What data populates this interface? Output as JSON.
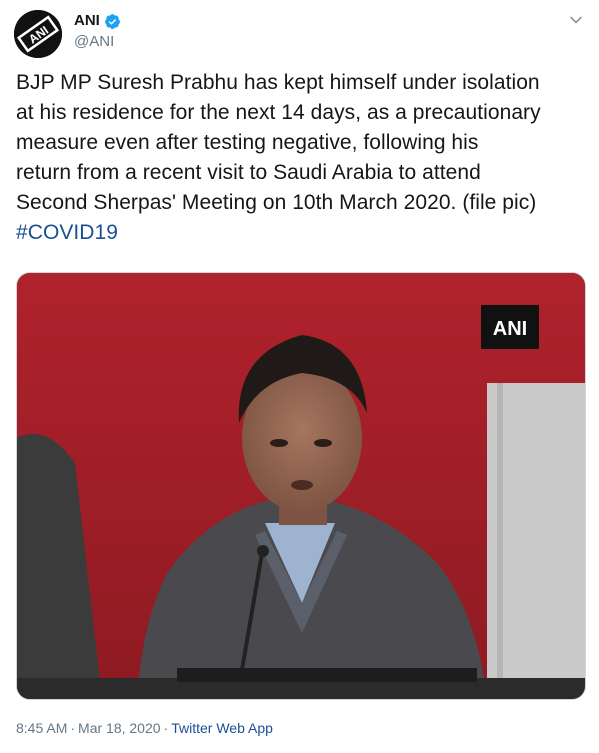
{
  "author": {
    "display_name": "ANI",
    "handle": "@ANI",
    "avatar_text": "ANI"
  },
  "tweet": {
    "lines": [
      "BJP MP Suresh Prabhu has kept himself under isolation",
      "at his residence for the next 14 days, as a precautionary",
      "measure even after testing negative, following his",
      "return from a recent visit to Saudi Arabia to attend",
      "Second Sherpas' Meeting on 10th March 2020. (file pic)"
    ],
    "hashtag": "#COVID19"
  },
  "media": {
    "watermark": "ANI"
  },
  "footer": {
    "time": "8:45 AM",
    "separator": "·",
    "date": "Mar 18, 2020",
    "source": "Twitter Web App"
  },
  "colors": {
    "text": "#14171a",
    "secondary": "#657786",
    "link": "#1b4f95",
    "verified": "#1da1f2"
  },
  "icons": {
    "verified": "verified-badge-icon",
    "menu": "chevron-down-icon"
  }
}
